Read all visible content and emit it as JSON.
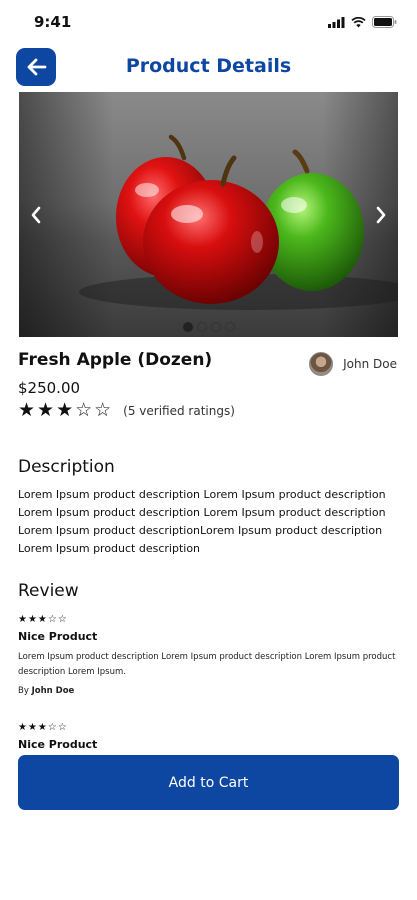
{
  "status_bar": {
    "time": "9:41"
  },
  "header": {
    "title": "Product Details",
    "back_icon": "arrow-left-icon"
  },
  "carousel": {
    "image": "red-and-green-apples-photo",
    "slide_count": 4,
    "active_slide": 1,
    "prev_icon": "chevron-left-icon",
    "next_icon": "chevron-right-icon"
  },
  "product": {
    "name": "Fresh Apple (Dozen)",
    "price": "$250.00",
    "rating": 3,
    "rating_max": 5,
    "rating_text": "(5 verified ratings)"
  },
  "seller": {
    "name": "John Doe"
  },
  "description": {
    "title": "Description",
    "text": "Lorem Ipsum product description Lorem Ipsum product description Lorem Ipsum product description Lorem Ipsum product description Lorem Ipsum product descriptionLorem Ipsum product description Lorem Ipsum product description"
  },
  "reviews": {
    "title": "Review",
    "items": [
      {
        "rating": 3,
        "title": "Nice Product",
        "body": "Lorem Ipsum product description Lorem Ipsum product description Lorem Ipsum product description Lorem Ipsum.",
        "by_label": "By",
        "author": "John Doe"
      },
      {
        "rating": 3,
        "title": "Nice Product"
      }
    ]
  },
  "cart_button": {
    "label": "Add to Cart"
  },
  "colors": {
    "primary": "#0d47a1",
    "background": "#ffffff",
    "text": "#111111"
  }
}
